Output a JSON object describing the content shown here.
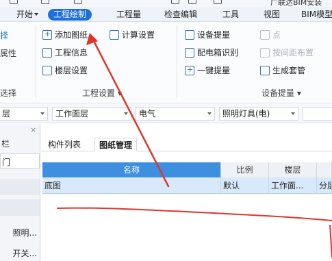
{
  "app": {
    "title": "广联达BIM安装"
  },
  "menu": {
    "tabs": [
      {
        "label": "开始",
        "active": false
      },
      {
        "label": "工程绘制",
        "active": true
      },
      {
        "label": "工程量",
        "active": false
      },
      {
        "label": "检查编辑",
        "active": false
      },
      {
        "label": "工具",
        "active": false
      },
      {
        "label": "视图",
        "active": false
      },
      {
        "label": "BIM模型",
        "active": false
      }
    ]
  },
  "ribbon": {
    "left_clip": {
      "row1": "择",
      "row2": "属性",
      "group": "选择"
    },
    "project_settings": {
      "add_drawing": "添加图纸",
      "calc_settings": "计算设置",
      "project_info": "工程信息",
      "floor_settings": "楼层设置",
      "group_label": "工程设置 ▾"
    },
    "device_extract": {
      "device_extract": "设备提量",
      "point": "点",
      "panel_identify": "配电箱识别",
      "spacing_layout": "按间距布置",
      "one_click": "一键提量",
      "gen_sleeve": "生成套管",
      "group_label": "设备提量 ▾"
    }
  },
  "dropdowns": {
    "clipped": "层",
    "floor": "工作面层",
    "discipline": "电气",
    "component": "照明灯具(电)"
  },
  "left_panel": {
    "close": "×",
    "clip_top": "栏",
    "clip_box": "门",
    "items": [
      "照明...",
      "开关..."
    ]
  },
  "main": {
    "tabs": [
      {
        "label": "构件列表",
        "active": false
      },
      {
        "label": "图纸管理",
        "active": true
      }
    ],
    "grid": {
      "columns": [
        "名称",
        "比例",
        "楼层",
        ""
      ],
      "rows": [
        [
          "底图",
          "默认",
          "工作面...",
          "分层"
        ]
      ]
    }
  },
  "colors": {
    "accent": "#1e6fd9",
    "header_selected": "#3f8fe0",
    "row_selected": "#d7e9fb",
    "annotation": "#e0342a"
  }
}
